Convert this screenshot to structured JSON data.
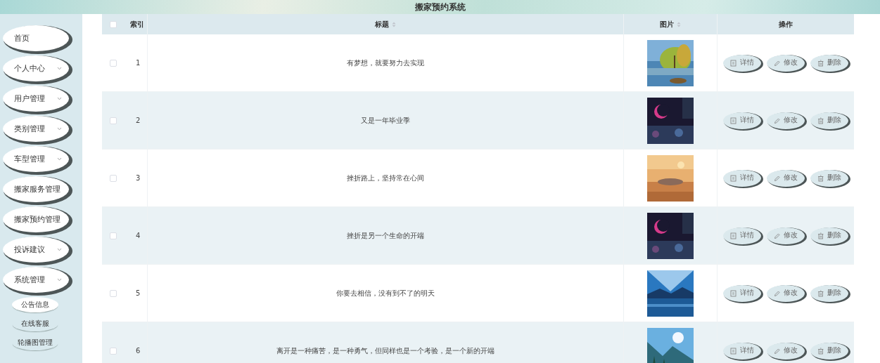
{
  "header": {
    "title": "搬家预约系统"
  },
  "sidebar": {
    "items": [
      {
        "label": "首页",
        "expandable": false
      },
      {
        "label": "个人中心",
        "expandable": true
      },
      {
        "label": "用户管理",
        "expandable": true
      },
      {
        "label": "类别管理",
        "expandable": true
      },
      {
        "label": "车型管理",
        "expandable": true
      },
      {
        "label": "搬家服务管理",
        "expandable": false
      },
      {
        "label": "搬家预约管理",
        "expandable": false
      },
      {
        "label": "投诉建议",
        "expandable": true
      },
      {
        "label": "系统管理",
        "expandable": true,
        "children": [
          {
            "label": "公告信息",
            "selected": true
          },
          {
            "label": "在线客服",
            "selected": false
          },
          {
            "label": "轮播图管理",
            "selected": false
          }
        ]
      }
    ]
  },
  "table": {
    "all_checked": false,
    "columns": [
      {
        "label": "索引",
        "sortable": false
      },
      {
        "label": "标题",
        "sortable": true
      },
      {
        "label": "图片",
        "sortable": true
      },
      {
        "label": "操作",
        "sortable": false
      }
    ],
    "rows": [
      {
        "index": "1",
        "title": "有梦想，就要努力去实现",
        "checked": false,
        "image": {
          "kind": "picture"
        },
        "actions": [
          {
            "label": "详情",
            "kind": "detail"
          },
          {
            "label": "修改",
            "kind": "edit"
          },
          {
            "label": "删除",
            "kind": "delete"
          }
        ]
      },
      {
        "index": "2",
        "title": "又是一年毕业季",
        "checked": false,
        "image": {
          "kind": "picture"
        },
        "actions": [
          {
            "label": "详情",
            "kind": "detail"
          },
          {
            "label": "修改",
            "kind": "edit"
          },
          {
            "label": "删除",
            "kind": "delete"
          }
        ]
      },
      {
        "index": "3",
        "title": "挫折路上，坚持常在心间",
        "checked": false,
        "image": {
          "kind": "picture"
        },
        "actions": [
          {
            "label": "详情",
            "kind": "detail"
          },
          {
            "label": "修改",
            "kind": "edit"
          },
          {
            "label": "删除",
            "kind": "delete"
          }
        ]
      },
      {
        "index": "4",
        "title": "挫折是另一个生命的开端",
        "checked": false,
        "image": {
          "kind": "picture"
        },
        "actions": [
          {
            "label": "详情",
            "kind": "detail"
          },
          {
            "label": "修改",
            "kind": "edit"
          },
          {
            "label": "删除",
            "kind": "delete"
          }
        ]
      },
      {
        "index": "5",
        "title": "你要去相信，没有到不了的明天",
        "checked": false,
        "image": {
          "kind": "picture"
        },
        "actions": [
          {
            "label": "详情",
            "kind": "detail"
          },
          {
            "label": "修改",
            "kind": "edit"
          },
          {
            "label": "删除",
            "kind": "delete"
          }
        ]
      },
      {
        "index": "6",
        "title": "离开是一种痛苦，是一种勇气，但同样也是一个考验，是一个新的开端",
        "checked": false,
        "image": {
          "kind": "picture"
        },
        "actions": [
          {
            "label": "详情",
            "kind": "detail"
          },
          {
            "label": "修改",
            "kind": "edit"
          },
          {
            "label": "删除",
            "kind": "delete"
          }
        ]
      }
    ]
  }
}
